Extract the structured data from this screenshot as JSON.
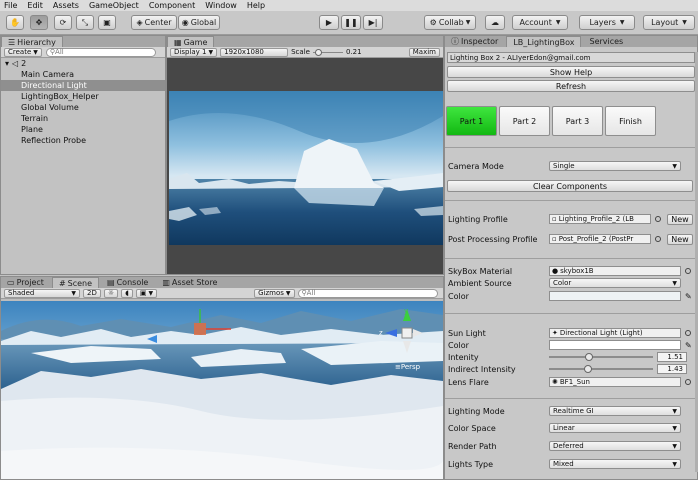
{
  "menu": [
    "File",
    "Edit",
    "Assets",
    "GameObject",
    "Component",
    "Window",
    "Help"
  ],
  "toolbar": {
    "pivot_label": "Center",
    "space_label": "Global",
    "collab_label": "Collab",
    "account_label": "Account",
    "layers_label": "Layers",
    "layout_label": "Layout"
  },
  "hierarchy": {
    "tab": "Hierarchy",
    "create_label": "Create",
    "search_placeholder": "All",
    "scene_name": "2",
    "items": [
      {
        "label": "Main Camera",
        "selected": false
      },
      {
        "label": "Directional Light",
        "selected": true
      },
      {
        "label": "LightingBox_Helper",
        "selected": false
      },
      {
        "label": "Global Volume",
        "selected": false
      },
      {
        "label": "Terrain",
        "selected": false
      },
      {
        "label": "Plane",
        "selected": false
      },
      {
        "label": "Reflection Probe",
        "selected": false
      }
    ]
  },
  "game": {
    "tab": "Game",
    "display": "Display 1",
    "resolution": "1920x1080",
    "scale_label": "Scale",
    "scale_value": "0.21",
    "scale_fraction": 0.1,
    "maximize": "Maxim"
  },
  "bottom_tabs": {
    "project": "Project",
    "scene": "Scene",
    "console": "Console",
    "asset_store": "Asset Store"
  },
  "scene": {
    "shading": "Shaded",
    "mode_2d": "2D",
    "gizmos": "Gizmos",
    "search_placeholder": "All",
    "persp_label": "Persp",
    "axis_y": "y",
    "axis_z": "z"
  },
  "inspector": {
    "tabs": [
      "Inspector",
      "LB_LightingBox",
      "Services"
    ],
    "header": "Lighting Box 2 - ALIyerEdon@gmail.com",
    "show_help": "Show Help",
    "refresh": "Refresh",
    "parts": [
      "Part 1",
      "Part 2",
      "Part 3",
      "Finish"
    ],
    "camera_mode_label": "Camera Mode",
    "camera_mode_value": "Single",
    "clear_components": "Clear Components",
    "lighting_profile_label": "Lighting Profile",
    "lighting_profile_value": "Lighting_Profile_2 (LB",
    "post_profile_label": "Post Processing Profile",
    "post_profile_value": "Post_Profile_2 (PostPr",
    "new_label": "New",
    "skybox_label": "SkyBox Material",
    "skybox_value": "skybox1B",
    "ambient_source_label": "Ambient Source",
    "ambient_source_value": "Color",
    "color_label": "Color",
    "sun_light_label": "Sun Light",
    "sun_light_value": "Directional Light (Light)",
    "intensity_label": "Intenity",
    "intensity_value": "1.51",
    "intensity_fraction": 0.38,
    "indirect_label": "Indirect Intensity",
    "indirect_value": "1.43",
    "indirect_fraction": 0.36,
    "lens_flare_label": "Lens Flare",
    "lens_flare_value": "BF1_Sun",
    "lighting_mode_label": "Lighting Mode",
    "lighting_mode_value": "Realtime GI",
    "color_space_label": "Color Space",
    "color_space_value": "Linear",
    "render_path_label": "Render Path",
    "render_path_value": "Deferred",
    "lights_type_label": "Lights Type",
    "lights_type_value": "Mixed"
  },
  "colors": {
    "accent_green": "#22d022",
    "selection": "#8f8f8f"
  }
}
